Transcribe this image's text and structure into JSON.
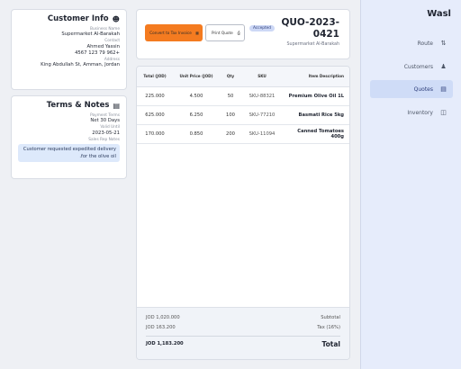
{
  "customer": {
    "title": "Customer Info",
    "business_name_label": "Business Name",
    "business_name": "Supermarket Al-Barakah",
    "contact_label": "Contact",
    "contact_name": "Ahmed Yassin",
    "phone": "4567 123 79 962+",
    "address_label": "Address",
    "address": "King Abdullah St, Amman, Jordan"
  },
  "terms": {
    "title": "Terms & Notes",
    "payment_terms_label": "Payment Terms",
    "payment_terms": "Net 30 Days",
    "valid_until_label": "Valid Until",
    "valid_until": "2023-05-21",
    "rep_notes_label": "Sales Rep Notes",
    "rep_notes": "Customer requested expedited delivery for the olive oil."
  },
  "header": {
    "convert_label": "Convert to Tax Invoice",
    "print_label": "Print Quote",
    "status_badge": "Accepted",
    "quote_number": "QUO-2023-0421",
    "customer_name": "Supermarket Al-Barakah"
  },
  "table": {
    "columns": {
      "total": "Total (JOD)",
      "unit_price": "Unit Price (JOD)",
      "qty": "Qty",
      "sku": "SKU",
      "description": "Item Description"
    },
    "rows": [
      {
        "total": "225.000",
        "unit_price": "4.500",
        "qty": "50",
        "sku": "SKU-88321",
        "description": "Premium Olive Oil 1L"
      },
      {
        "total": "625.000",
        "unit_price": "6.250",
        "qty": "100",
        "sku": "SKU-77210",
        "description": "Basmati Rice 5kg"
      },
      {
        "total": "170.000",
        "unit_price": "0.850",
        "qty": "200",
        "sku": "SKU-11094",
        "description": "Canned Tomatoes 400g"
      }
    ]
  },
  "totals": {
    "subtotal_label": "Subtotal",
    "subtotal_value": "JOD 1,020.000",
    "tax_label": "Tax (16%)",
    "tax_value": "JOD 163.200",
    "total_label": "Total",
    "total_value": "JOD 1,183.200"
  },
  "sidebar": {
    "brand": "Wasl",
    "items": [
      {
        "label": "Route",
        "icon": "route-icon",
        "active": false
      },
      {
        "label": "Customers",
        "icon": "customers-icon",
        "active": false
      },
      {
        "label": "Quotes",
        "icon": "quotes-icon",
        "active": true
      },
      {
        "label": "Inventory",
        "icon": "inventory-icon",
        "active": false
      }
    ]
  },
  "colors": {
    "accent_orange": "#f47b20",
    "sidebar_bg": "#e6ecfb",
    "active_nav": "#cfdcf7",
    "badge_bg": "#cdd8f6"
  }
}
